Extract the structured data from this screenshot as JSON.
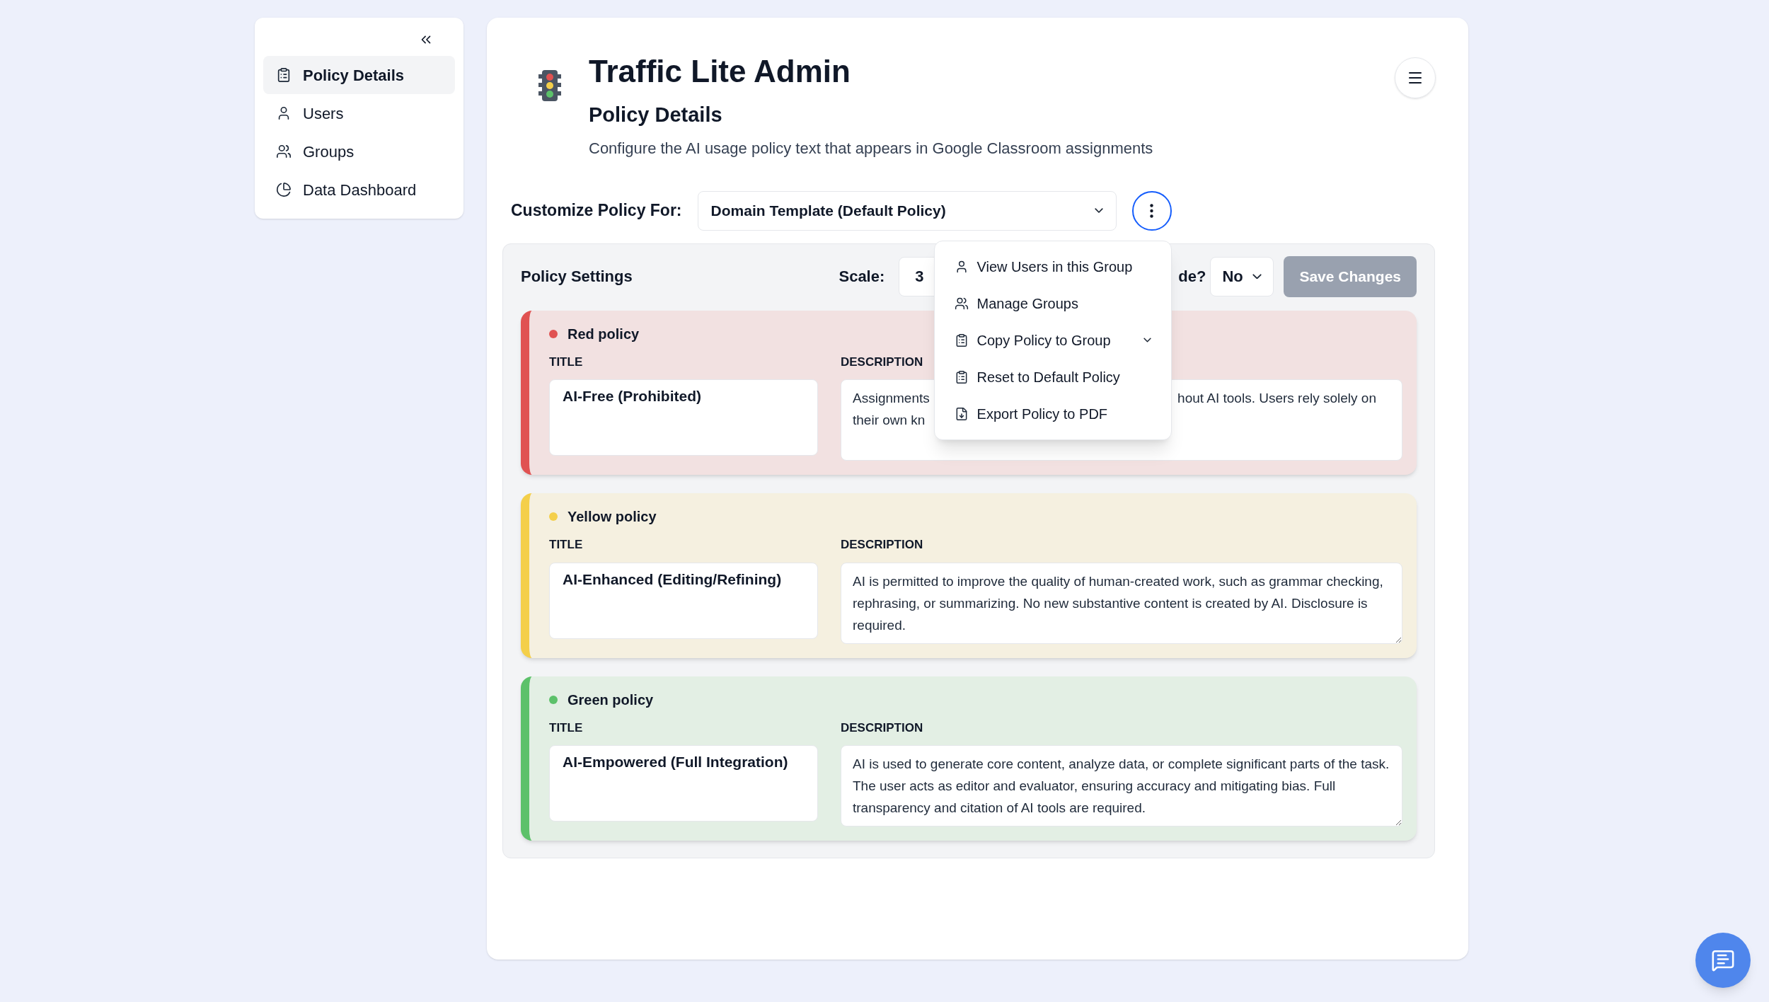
{
  "sidebar": {
    "items": [
      {
        "label": "Policy Details",
        "kind": "clipboard",
        "selected": true
      },
      {
        "label": "Users",
        "kind": "user",
        "selected": false
      },
      {
        "label": "Groups",
        "kind": "users",
        "selected": false
      },
      {
        "label": "Data Dashboard",
        "kind": "pie",
        "selected": false
      }
    ]
  },
  "header": {
    "title": "Traffic Lite Admin",
    "subtitle": "Policy Details",
    "description": "Configure the AI usage policy text that appears in Google Classroom assignments"
  },
  "customize": {
    "label": "Customize Policy For:",
    "value": "Domain Template (Default Policy)"
  },
  "menu": {
    "items": [
      {
        "label": "View Users in this Group",
        "kind": "user",
        "submenu": false
      },
      {
        "label": "Manage Groups",
        "kind": "users",
        "submenu": false
      },
      {
        "label": "Copy Policy to Group",
        "kind": "clipboard",
        "submenu": true
      },
      {
        "label": "Reset to Default Policy",
        "kind": "clipboard",
        "submenu": false
      },
      {
        "label": "Export Policy to PDF",
        "kind": "download",
        "submenu": false
      }
    ]
  },
  "settings": {
    "title": "Policy Settings",
    "scale_label": "Scale:",
    "scale_value": "3",
    "override_label": "de?",
    "override_value": "No",
    "save": {
      "label": "Save Changes",
      "disabled": true
    }
  },
  "policies": [
    {
      "name": "Red policy",
      "color": "#e05252",
      "title_label": "TITLE",
      "title": "AI-Free (Prohibited)",
      "description_label": "DESCRIPTION",
      "description_parts": [
        "Assignments",
        "hout AI tools. Users rely solely on",
        "their own kn"
      ]
    },
    {
      "name": "Yellow policy",
      "color": "#f4cf4a",
      "title_label": "TITLE",
      "title": "AI-Enhanced (Editing/Refining)",
      "description_label": "DESCRIPTION",
      "description": "AI is permitted to improve the quality of human-created work, such as grammar checking, rephrasing, or summarizing. No new substantive content is created by AI. Disclosure is required."
    },
    {
      "name": "Green policy",
      "color": "#5cc16a",
      "title_label": "TITLE",
      "title": "AI-Empowered (Full Integration)",
      "description_label": "DESCRIPTION",
      "description": "AI is used to generate core content, analyze data, or complete significant parts of the task. The user acts as editor and evaluator, ensuring accuracy and mitigating bias. Full transparency and citation of AI tools are required."
    }
  ]
}
